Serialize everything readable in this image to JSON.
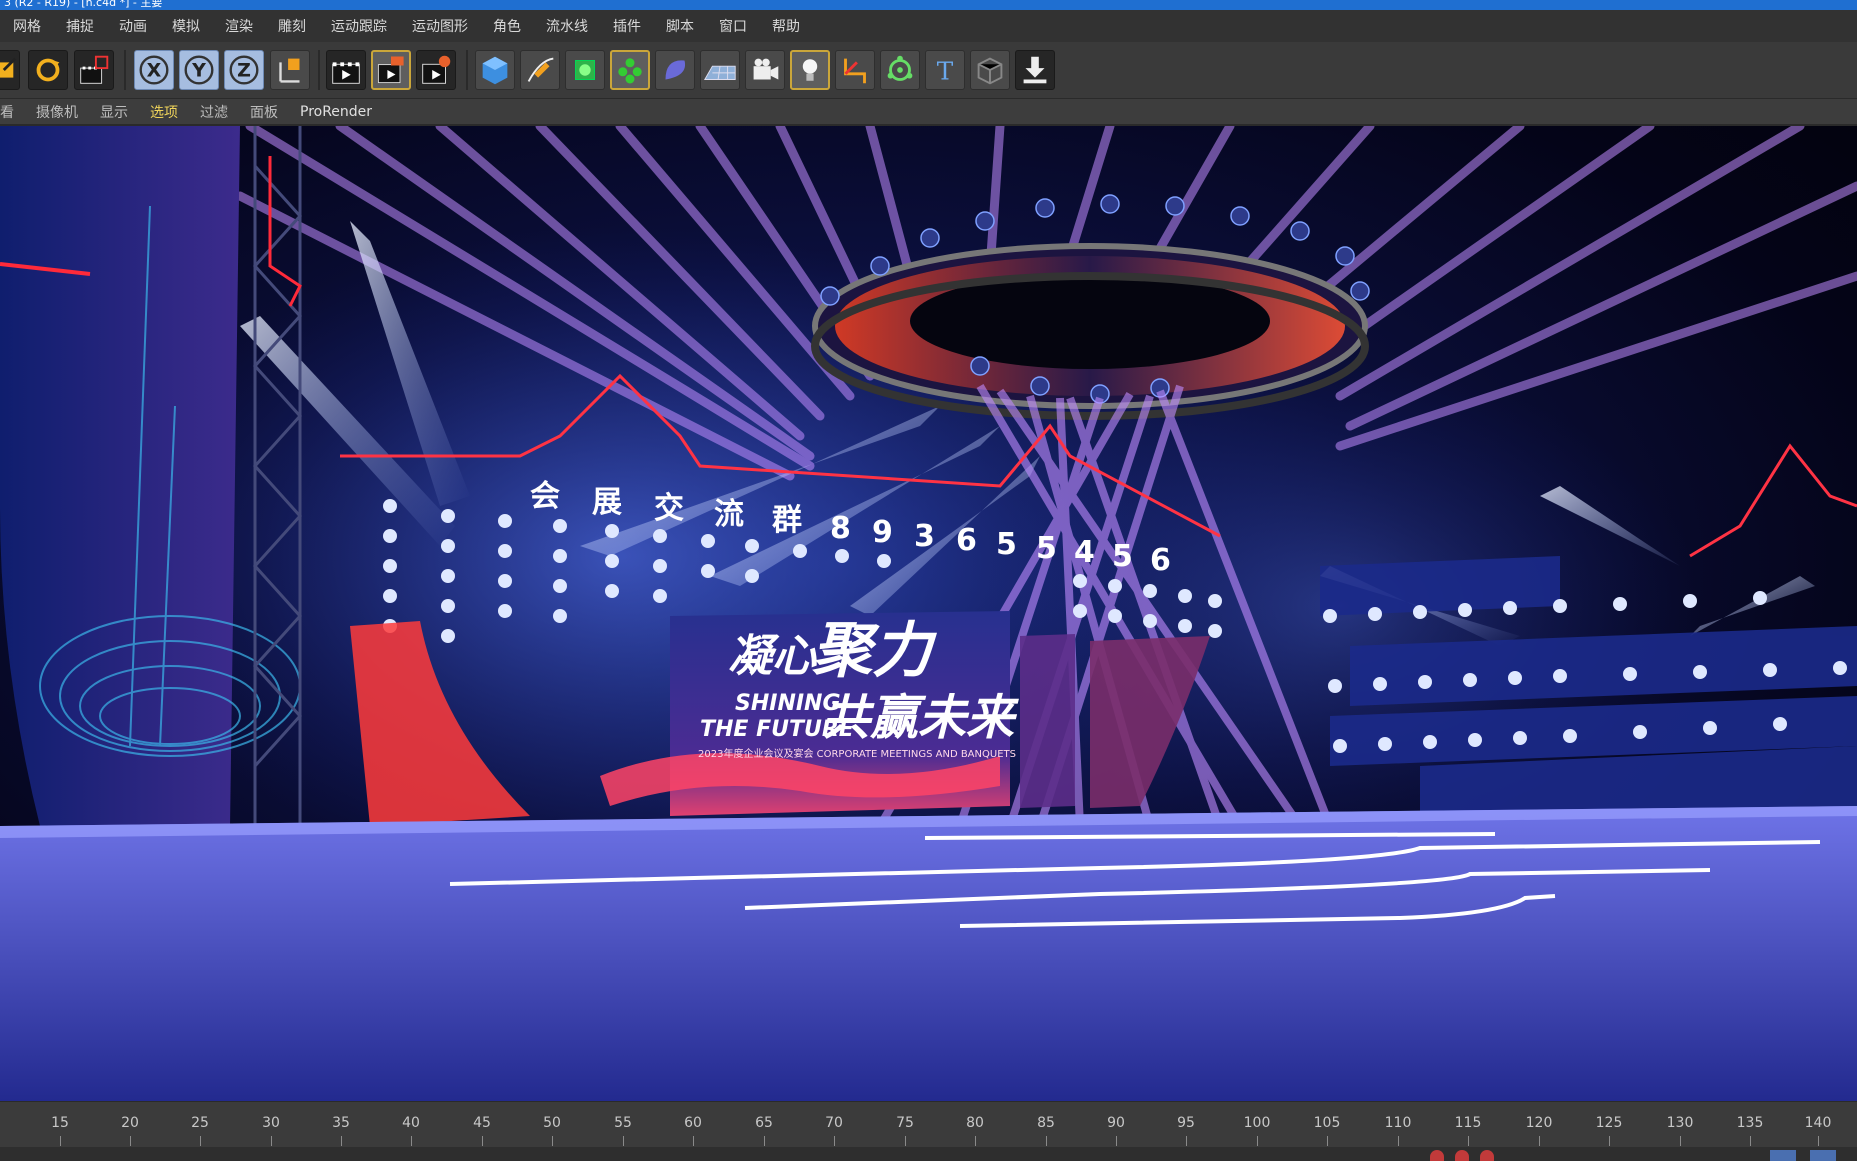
{
  "window": {
    "title": "3 (R2 - R19) - [n.c4d *] - 主要"
  },
  "menu": [
    "网格",
    "捕捉",
    "动画",
    "模拟",
    "渲染",
    "雕刻",
    "运动跟踪",
    "运动图形",
    "角色",
    "流水线",
    "插件",
    "脚本",
    "窗口",
    "帮助"
  ],
  "toolbar": {
    "icons": [
      "move-icon",
      "rotate-icon",
      "render-settings-icon",
      "x-axis-icon",
      "y-axis-icon",
      "z-axis-icon",
      "coordinate-system-icon",
      "render-view-icon",
      "render-picture-viewer-icon",
      "edit-render-settings-icon",
      "cube-icon",
      "pen-icon",
      "subdivision-icon",
      "cloner-icon",
      "deformer-icon",
      "floor-icon",
      "camera-icon",
      "light-icon",
      "joint-icon",
      "effector-icon",
      "text-icon",
      "instance-icon",
      "import-icon"
    ],
    "x_label": "X",
    "y_label": "Y",
    "z_label": "Z",
    "text_label": "T"
  },
  "view_menu": [
    "查看",
    "摄像机",
    "显示",
    "选项",
    "过滤",
    "面板",
    "ProRender"
  ],
  "viewport": {
    "scene_text": {
      "group_label": [
        "会",
        "展",
        "交",
        "流",
        "群"
      ],
      "group_number": [
        "8",
        "9",
        "3",
        "6",
        "5",
        "5",
        "4",
        "5",
        "6"
      ],
      "title_cn_1": "凝心",
      "title_cn_2": "聚力",
      "title_en_1": "SHINING",
      "title_en_2": "THE FUTURE",
      "title_cn_3": "共赢未来",
      "subtitle": "2023年度企业会议及宴会 CORPORATE MEETINGS AND BANQUETS"
    },
    "colors": {
      "sky": "#0b0f3c",
      "beam_purple": "#c08cff",
      "beam_white": "#dfe8ff",
      "outline_red": "#ff2a3a",
      "stage_floor": "#3a3fb5"
    }
  },
  "timeline": {
    "ticks": [
      15,
      20,
      25,
      30,
      35,
      40,
      45,
      50,
      55,
      60,
      65,
      70,
      75,
      80,
      85,
      90,
      95,
      100,
      105,
      110,
      115,
      120,
      125,
      130,
      135,
      140
    ]
  }
}
